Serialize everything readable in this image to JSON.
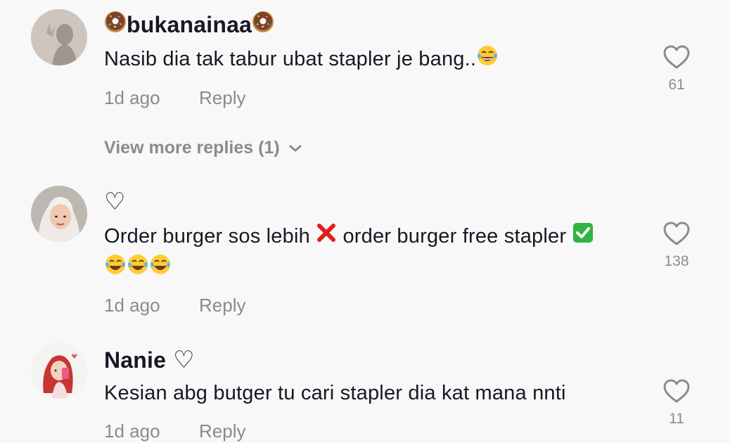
{
  "comments": [
    {
      "username": "bukanainaa",
      "username_decoration": "donut-icon",
      "text": "Nasib dia tak tabur ubat stapler je bang..",
      "text_emoji": "tears-of-joy-emoji",
      "time": "1d ago",
      "reply_label": "Reply",
      "likes": "61",
      "view_more_label": "View more replies (1)"
    },
    {
      "username": "♡",
      "text_part1": "Order burger sos lebih",
      "text_part2": "order burger free stapler",
      "time": "1d ago",
      "reply_label": "Reply",
      "likes": "138"
    },
    {
      "username": "Nanie",
      "username_suffix": "♡",
      "text": "Kesian abg butger tu cari stapler dia kat mana nnti",
      "time": "1d ago",
      "reply_label": "Reply",
      "likes": "11"
    }
  ],
  "colors": {
    "background": "#f8f8f8",
    "text_primary": "#161823",
    "text_secondary": "#8a8b91",
    "cross_emoji": "#e0201b",
    "check_emoji": "#2fb344"
  }
}
